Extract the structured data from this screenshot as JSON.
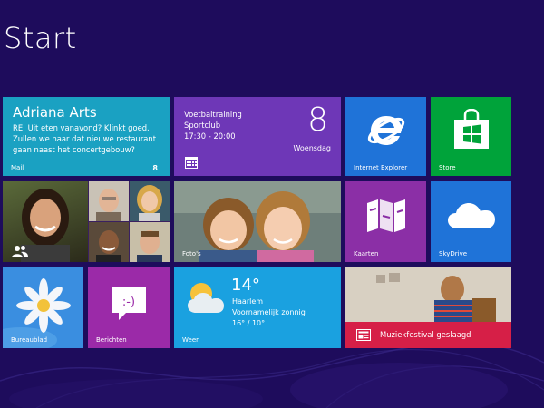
{
  "screen": {
    "title": "Start"
  },
  "tiles": {
    "mail": {
      "sender": "Adriana Arts",
      "preview": "RE: Uit eten vanavond? Klinkt goed. Zullen we naar dat nieuwe restaurant gaan naast het concertgebouw?",
      "label": "Mail",
      "badge": "8",
      "color": "#1aa1c2"
    },
    "calendar": {
      "event_title": "Voetbaltraining",
      "event_location": "Sportclub",
      "event_time": "17:30 - 20:00",
      "date": "8",
      "day": "Woensdag",
      "icon": "calendar-icon",
      "color": "#6e37b7"
    },
    "ie": {
      "label": "Internet Explorer",
      "icon": "internet-explorer-icon",
      "color": "#1f73d8"
    },
    "store": {
      "label": "Store",
      "icon": "store-bag-icon",
      "color": "#00a33a"
    },
    "people": {
      "icon": "people-icon"
    },
    "photos": {
      "label": "Foto's"
    },
    "maps": {
      "label": "Kaarten",
      "icon": "map-icon",
      "color": "#8b2fa6"
    },
    "skydrive": {
      "label": "SkyDrive",
      "icon": "cloud-icon",
      "color": "#1f73d8"
    },
    "desktop": {
      "label": "Bureaublad"
    },
    "messaging": {
      "label": "Berichten",
      "icon": "smiley-chat-icon",
      "color": "#9b2aa8"
    },
    "weather": {
      "temperature": "14°",
      "city": "Haarlem",
      "condition": "Voornamelijk zonnig",
      "range": "16° / 10°",
      "label": "Weer",
      "icon": "sun-cloud-icon",
      "color": "#1aa1e0"
    },
    "music": {
      "text": "Muziekfestival geslaagd",
      "icon": "news-icon",
      "color": "#d61f47"
    }
  }
}
